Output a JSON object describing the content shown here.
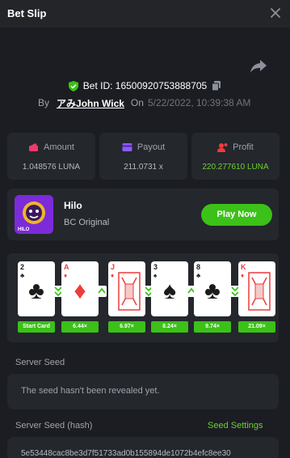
{
  "header": {
    "title": "Bet Slip"
  },
  "bet": {
    "id_text": "Bet ID: 16500920753888705",
    "by_label": "By",
    "user": "アみJohn Wick",
    "on_label": "On",
    "date": "5/22/2022, 10:39:38 AM"
  },
  "stats": [
    {
      "label": "Amount",
      "value": "1.048576 LUNA",
      "icon": "wallet-icon"
    },
    {
      "label": "Payout",
      "value": "211.0731 x",
      "icon": "card-icon"
    },
    {
      "label": "Profit",
      "value": "220.277610 LUNA",
      "icon": "profit-icon"
    }
  ],
  "game": {
    "name": "Hilo",
    "subtitle": "BC Original",
    "play_label": "Play Now",
    "logo_text": "HILO"
  },
  "cards": [
    {
      "rank": "2",
      "suit": "♣",
      "color": "black"
    },
    {
      "rank": "A",
      "suit": "♦",
      "color": "red"
    },
    {
      "rank": "J",
      "suit": "♦",
      "color": "red"
    },
    {
      "rank": "3",
      "suit": "♠",
      "color": "black"
    },
    {
      "rank": "8",
      "suit": "♣",
      "color": "black"
    },
    {
      "rank": "K",
      "suit": "♦",
      "color": "red"
    }
  ],
  "arrows": [
    "down",
    "up",
    "down",
    "up",
    "down"
  ],
  "multipliers": [
    "Start Card",
    "6.44×",
    "6.97×",
    "8.24×",
    "9.74×",
    "21.09×"
  ],
  "seed": {
    "server_seed_label": "Server Seed",
    "server_seed_value": "The seed hasn't been revealed yet.",
    "hash_label": "Server Seed (hash)",
    "settings_label": "Seed Settings",
    "hash_value": "5e53448cac8be3d7f51733ad0b155894de1072b4efc8ee30"
  },
  "colors": {
    "accent": "#3bc117",
    "profit": "#6cd132",
    "background": "#1b1d22",
    "panel": "#24272c"
  }
}
